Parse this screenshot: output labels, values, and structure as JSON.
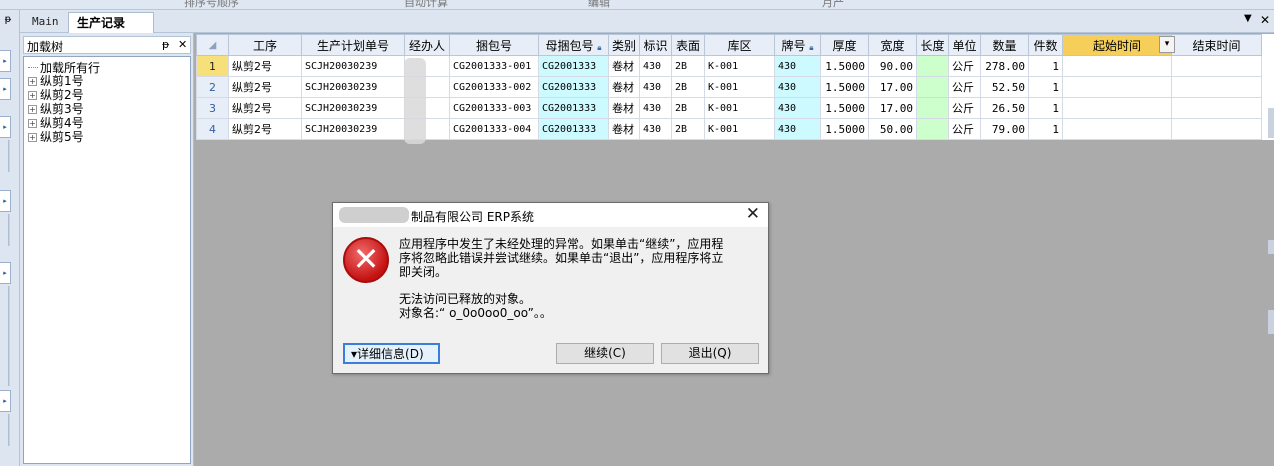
{
  "top_strip": [
    "排序号顺序",
    "自动计算",
    "编辑",
    "月产"
  ],
  "tabs": {
    "main": "Main",
    "active": "生产记录",
    "ctrl_dropdown": "▼",
    "ctrl_close": "✕"
  },
  "tree": {
    "title": "加载树",
    "pin": "ᵽ",
    "close": "✕",
    "items": [
      {
        "label": "加载所有行",
        "kind": "leaf"
      },
      {
        "label": "纵剪1号",
        "kind": "node"
      },
      {
        "label": "纵剪2号",
        "kind": "node"
      },
      {
        "label": "纵剪3号",
        "kind": "node"
      },
      {
        "label": "纵剪4号",
        "kind": "node"
      },
      {
        "label": "纵剪5号",
        "kind": "node"
      }
    ]
  },
  "grid": {
    "corner": "◢",
    "columns": [
      "工序",
      "生产计划单号",
      "经办人",
      "捆包号",
      "母捆包号",
      "类别",
      "标识",
      "表面",
      "库区",
      "牌号",
      "厚度",
      "宽度",
      "长度",
      "单位",
      "数量",
      "件数",
      "起始时间",
      "结束时间"
    ],
    "rows": [
      {
        "n": "1",
        "proc": "纵剪2号",
        "plan": "SCJH20030239",
        "handler": "",
        "bundle": "CG2001333-001",
        "parent": "CG2001333",
        "cat": "卷材",
        "mark": "430",
        "surf": "2B",
        "area": "K-001",
        "grade": "430",
        "thick": "1.5000",
        "width": "90.00",
        "len": "",
        "unit": "公斤",
        "qty": "278.00",
        "pcs": "1",
        "start": "",
        "end": ""
      },
      {
        "n": "2",
        "proc": "纵剪2号",
        "plan": "SCJH20030239",
        "handler": "",
        "bundle": "CG2001333-002",
        "parent": "CG2001333",
        "cat": "卷材",
        "mark": "430",
        "surf": "2B",
        "area": "K-001",
        "grade": "430",
        "thick": "1.5000",
        "width": "17.00",
        "len": "",
        "unit": "公斤",
        "qty": "52.50",
        "pcs": "1",
        "start": "",
        "end": ""
      },
      {
        "n": "3",
        "proc": "纵剪2号",
        "plan": "SCJH20030239",
        "handler": "",
        "bundle": "CG2001333-003",
        "parent": "CG2001333",
        "cat": "卷材",
        "mark": "430",
        "surf": "2B",
        "area": "K-001",
        "grade": "430",
        "thick": "1.5000",
        "width": "17.00",
        "len": "",
        "unit": "公斤",
        "qty": "26.50",
        "pcs": "1",
        "start": "",
        "end": ""
      },
      {
        "n": "4",
        "proc": "纵剪2号",
        "plan": "SCJH20030239",
        "handler": "",
        "bundle": "CG2001333-004",
        "parent": "CG2001333",
        "cat": "卷材",
        "mark": "430",
        "surf": "2B",
        "area": "K-001",
        "grade": "430",
        "thick": "1.5000",
        "width": "50.00",
        "len": "",
        "unit": "公斤",
        "qty": "79.00",
        "pcs": "1",
        "start": "",
        "end": ""
      }
    ]
  },
  "dialog": {
    "title": "制品有限公司 ERP系统",
    "close": "✕",
    "icon": "✕",
    "message_lines": [
      "应用程序中发生了未经处理的异常。如果单击“继续”，应用程",
      "序将忽略此错误并尝试继续。如果单击“退出”，应用程序将立",
      "即关闭。"
    ],
    "detail_lines": [
      "无法访问已释放的对象。",
      "对象名:“ o_0o0oo0_oo”。。"
    ],
    "buttons": {
      "details": "▾详细信息(D)",
      "continue": "继续(C)",
      "quit": "退出(Q)"
    }
  },
  "colors": {
    "accent_selected_header": "#f6cf5a",
    "cyan_column": "#cdfaff",
    "green_column": "#ccffcc",
    "error_red": "#c41212"
  }
}
